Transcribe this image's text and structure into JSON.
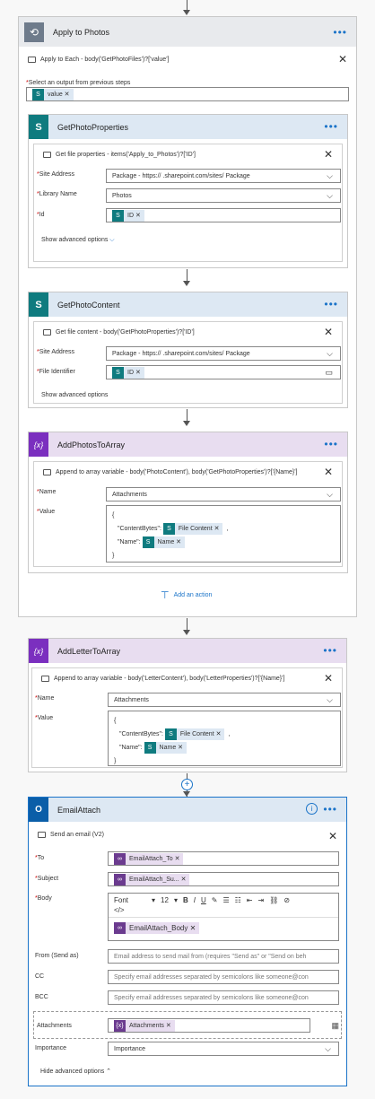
{
  "top_action": {
    "title": "Apply to Photos",
    "description": "Apply to Each - body('GetPhotoFiles')?['value']",
    "select_label": "Select an output from previous steps",
    "token": "value"
  },
  "get_props": {
    "title": "GetPhotoProperties",
    "description": "Get file properties - items('Apply_to_Photos')?['ID']",
    "site_label": "Site Address",
    "site_value": "Package - https://              .sharepoint.com/sites/                  Package",
    "library_label": "Library Name",
    "library_value": "Photos",
    "id_label": "Id",
    "id_token": "ID",
    "advanced": "Show advanced options"
  },
  "get_content": {
    "title": "GetPhotoContent",
    "description": "Get file content - body('GetPhotoProperties')?['ID']",
    "site_label": "Site Address",
    "site_value": "Package - https://              .sharepoint.com/sites/                  Package",
    "file_label": "File Identifier",
    "file_token": "ID",
    "advanced": "Show advanced options"
  },
  "add_photos": {
    "title": "AddPhotosToArray",
    "description": "Append to array variable - body('PhotoContent'), body('GetPhotoProperties')?['{Name}']",
    "name_label": "Name",
    "name_value": "Attachments",
    "value_label": "Value",
    "brace_open": "{",
    "line1_key": "\"ContentBytes\":",
    "line1_token": "File Content",
    "line1_comma": ",",
    "line2_key": "\"Name\":",
    "line2_token": "Name",
    "brace_close": "}"
  },
  "add_action": "Add an action",
  "add_letter": {
    "title": "AddLetterToArray",
    "description": "Append to array variable - body('LetterContent'), body('LetterProperties')?['{Name}']",
    "name_label": "Name",
    "name_value": "Attachments",
    "value_label": "Value",
    "brace_open": "{",
    "line1_key": "\"ContentBytes\":",
    "line1_token": "File Content",
    "line1_comma": ",",
    "line2_key": "\"Name\":",
    "line2_token": "Name",
    "brace_close": "}"
  },
  "email": {
    "title": "EmailAttach",
    "description": "Send an email (V2)",
    "to_label": "To",
    "to_token": "EmailAttach_To",
    "subject_label": "Subject",
    "subject_token": "EmailAttach_Su...",
    "body_label": "Body",
    "font": "Font",
    "font_size": "12",
    "body_token": "EmailAttach_Body",
    "from_label": "From (Send as)",
    "from_placeholder": "Email address to send mail from (requires \"Send as\" or \"Send on beh",
    "cc_label": "CC",
    "cc_placeholder": "Specify email addresses separated by semicolons like someone@con",
    "bcc_label": "BCC",
    "bcc_placeholder": "Specify email addresses separated by semicolons like someone@con",
    "attach_label": "Attachments",
    "attach_token": "Attachments",
    "importance_label": "Importance",
    "importance_value": "Importance",
    "hide_advanced": "Hide advanced options"
  },
  "colors": {
    "sharepoint": "#0f7b7f",
    "variable": "#7b2fbf",
    "outlook": "#0b5ea8",
    "accent": "#1a73c8"
  }
}
